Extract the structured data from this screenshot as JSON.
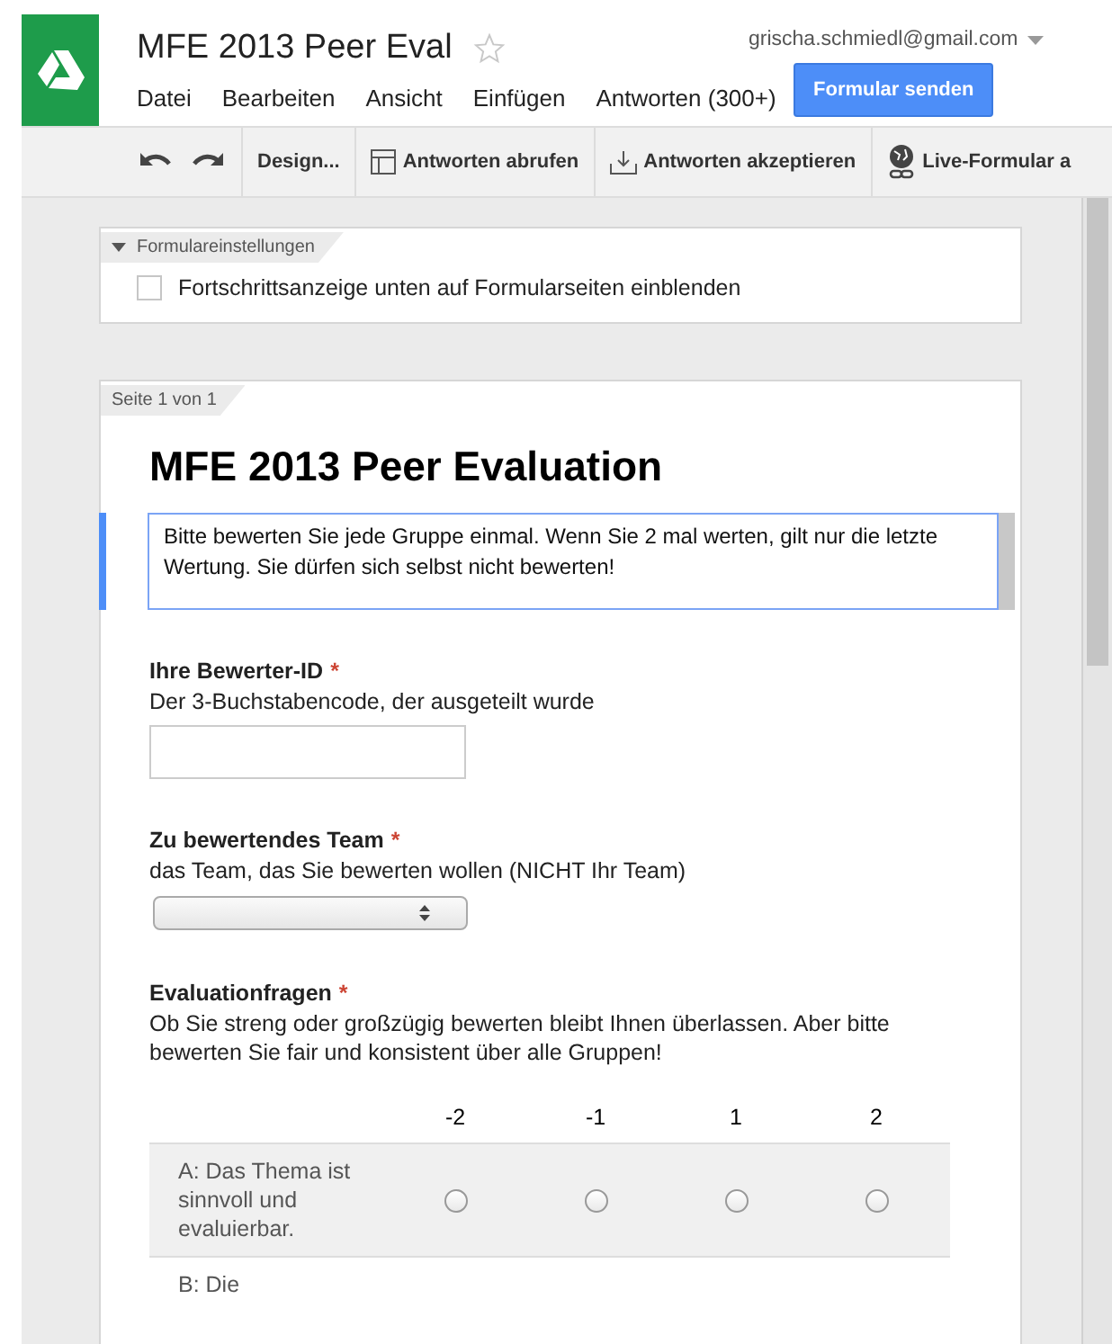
{
  "document": {
    "title": "MFE 2013 Peer Eval",
    "starred": false,
    "account": "grischa.schmiedl@gmail.com"
  },
  "menu": [
    "Datei",
    "Bearbeiten",
    "Ansicht",
    "Einfügen",
    "Antworten (300+)"
  ],
  "send_button": "Formular senden",
  "toolbar": [
    {
      "kind": "undo"
    },
    {
      "kind": "redo"
    },
    {
      "kind": "text",
      "label": "Design..."
    },
    {
      "kind": "table",
      "label": "Antworten abrufen"
    },
    {
      "kind": "download",
      "label": "Antworten akzeptieren"
    },
    {
      "kind": "globe",
      "label": "Live-Formular a"
    }
  ],
  "settings": {
    "title": "Formulareinstellungen",
    "expanded": true,
    "checkbox": {
      "label": "Fortschrittsanzeige unten auf Formularseiten einblenden",
      "checked": false
    }
  },
  "page": {
    "tab": "Seite 1 von 1",
    "title": "MFE 2013 Peer Evaluation",
    "description": "Bitte bewerten Sie jede Gruppe einmal. Wenn Sie 2 mal werten, gilt nur die letzte Wertung. Sie dürfen sich selbst nicht bewerten!",
    "description_focused": true,
    "questions": [
      {
        "kind": "text",
        "title": "Ihre Bewerter-ID",
        "required_mark": "*",
        "help": "Der 3-Buchstabencode, der ausgeteilt wurde"
      },
      {
        "kind": "select",
        "title": "Zu bewertendes Team",
        "required_mark": "*",
        "help": "das Team, das Sie bewerten wollen (NICHT Ihr Team)"
      },
      {
        "kind": "grid",
        "title": "Evaluationfragen",
        "required_mark": "*",
        "help": "Ob Sie streng oder großzügig bewerten bleibt Ihnen überlassen. Aber bitte bewerten Sie fair und konsistent über alle Gruppen!",
        "columns": [
          "-2",
          "-1",
          "1",
          "2"
        ],
        "rows": [
          {
            "label": "A: Das Thema ist sinnvoll und evaluierbar.",
            "options": [
              {
                "selected": false
              },
              {
                "selected": false
              },
              {
                "selected": false
              },
              {
                "selected": false
              }
            ]
          },
          {
            "label": "B: Die"
          }
        ]
      }
    ]
  }
}
